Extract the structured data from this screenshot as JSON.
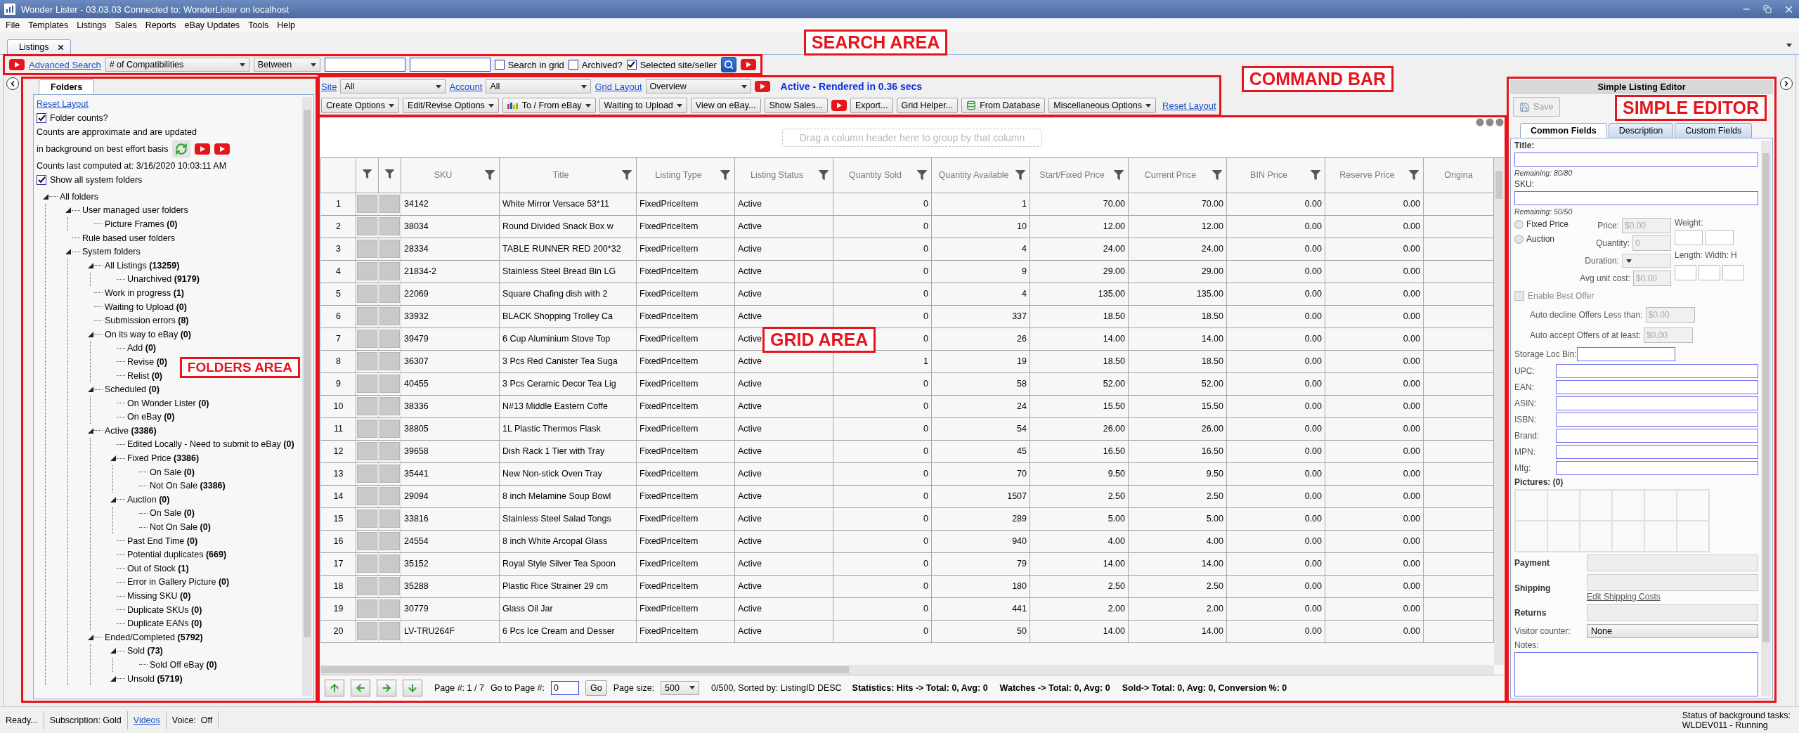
{
  "window": {
    "title": "Wonder Lister - 03.03.03 Connected to: WonderLister on localhost"
  },
  "menu": [
    "File",
    "Templates",
    "Listings",
    "Sales",
    "Reports",
    "eBay Updates",
    "Tools",
    "Help"
  ],
  "tabs": [
    {
      "label": "Listings",
      "selected": true
    }
  ],
  "search": {
    "annotation": "SEARCH AREA",
    "link": "Advanced Search",
    "field": "# of Compatibilities",
    "operator": "Between",
    "checkboxes": [
      {
        "label": "Search in grid",
        "checked": false
      },
      {
        "label": "Archived?",
        "checked": false
      },
      {
        "label": "Selected site/seller",
        "checked": true
      }
    ]
  },
  "folders": {
    "annotation": "FOLDERS AREA",
    "tab": "Folders",
    "reset_link": "Reset Layout",
    "folder_counts": {
      "label": "Folder counts?",
      "checked": true
    },
    "note_lines": [
      "Counts are approximate and are updated",
      "in background on best effort basis"
    ],
    "computed": "Counts last computed at: 3/16/2020 10:03:11 AM",
    "show_system": {
      "label": "Show all system folders",
      "checked": true
    },
    "tree": [
      {
        "name": "All folders",
        "expanded": true,
        "children": [
          {
            "name": "User managed user folders",
            "expanded": true,
            "children": [
              {
                "name": "Picture Frames",
                "count": "(0)"
              }
            ]
          },
          {
            "name": "Rule based user folders"
          },
          {
            "name": "System folders",
            "expanded": true,
            "children": [
              {
                "name": "All Listings",
                "count": "(13259)",
                "expanded": true,
                "children": [
                  {
                    "name": "Unarchived",
                    "count": "(9179)"
                  }
                ]
              },
              {
                "name": "Work in progress",
                "count": "(1)"
              },
              {
                "name": "Waiting to Upload",
                "count": "(0)"
              },
              {
                "name": "Submission errors",
                "count": "(8)"
              },
              {
                "name": "On its way to eBay",
                "count": "(0)",
                "expanded": true,
                "children": [
                  {
                    "name": "Add",
                    "count": "(0)"
                  },
                  {
                    "name": "Revise",
                    "count": "(0)"
                  },
                  {
                    "name": "Relist",
                    "count": "(0)"
                  }
                ]
              },
              {
                "name": "Scheduled",
                "count": "(0)",
                "expanded": true,
                "children": [
                  {
                    "name": "On Wonder Lister",
                    "count": "(0)"
                  },
                  {
                    "name": "On eBay",
                    "count": "(0)"
                  }
                ]
              },
              {
                "name": "Active",
                "count": "(3386)",
                "expanded": true,
                "children": [
                  {
                    "name": "Edited Locally - Need to submit to eBay",
                    "count": "(0)"
                  },
                  {
                    "name": "Fixed Price",
                    "count": "(3386)",
                    "expanded": true,
                    "children": [
                      {
                        "name": "On Sale",
                        "count": "(0)"
                      },
                      {
                        "name": "Not On Sale",
                        "count": "(3386)"
                      }
                    ]
                  },
                  {
                    "name": "Auction",
                    "count": "(0)",
                    "expanded": true,
                    "children": [
                      {
                        "name": "On Sale",
                        "count": "(0)"
                      },
                      {
                        "name": "Not On Sale",
                        "count": "(0)"
                      }
                    ]
                  },
                  {
                    "name": "Past End Time",
                    "count": "(0)"
                  },
                  {
                    "name": "Potential duplicates",
                    "count": "(669)"
                  },
                  {
                    "name": "Out of Stock",
                    "count": "(1)"
                  },
                  {
                    "name": "Error in Gallery Picture",
                    "count": "(0)"
                  },
                  {
                    "name": "Missing SKU",
                    "count": "(0)"
                  },
                  {
                    "name": "Duplicate SKUs",
                    "count": "(0)"
                  },
                  {
                    "name": "Duplicate EANs",
                    "count": "(0)"
                  }
                ]
              },
              {
                "name": "Ended/Completed",
                "count": "(5792)",
                "expanded": true,
                "children": [
                  {
                    "name": "Sold",
                    "count": "(73)",
                    "expanded": true,
                    "children": [
                      {
                        "name": "Sold Off eBay",
                        "count": "(0)"
                      }
                    ]
                  },
                  {
                    "name": "Unsold",
                    "count": "(5719)",
                    "expanded": true
                  }
                ]
              }
            ]
          }
        ]
      }
    ]
  },
  "command_bar": {
    "annotation": "COMMAND BAR",
    "filters": [
      {
        "label": "Site",
        "value": "All"
      },
      {
        "label": "Account",
        "value": "All"
      },
      {
        "label": "Grid Layout",
        "value": "Overview"
      }
    ],
    "status": "Active - Rendered in 0.36 secs",
    "buttons": [
      {
        "kind": "menu",
        "label": "Create Options"
      },
      {
        "kind": "menu",
        "label": "Edit/Revise Options"
      },
      {
        "kind": "transfer",
        "label": "To / From eBay"
      },
      {
        "kind": "menu",
        "label": "Waiting to Upload"
      },
      {
        "kind": "button",
        "label": "View on eBay..."
      },
      {
        "kind": "button",
        "label": "Show Sales..."
      },
      {
        "kind": "video"
      },
      {
        "kind": "button",
        "label": "Export..."
      },
      {
        "kind": "button",
        "label": "Grid Helper..."
      },
      {
        "kind": "database",
        "label": "From Database"
      },
      {
        "kind": "menu",
        "label": "Miscellaneous Options"
      },
      {
        "kind": "link",
        "label": "Reset Layout"
      }
    ]
  },
  "grid": {
    "annotation": "GRID AREA",
    "group_hint": "Drag a column header here to group by that column",
    "columns": [
      "SKU",
      "Title",
      "Listing Type",
      "Listing Status",
      "Quantity Sold",
      "Quantity Available",
      "Start/Fixed Price",
      "Current Price",
      "BIN Price",
      "Reserve Price",
      "Origina"
    ],
    "rows": [
      {
        "number": "1",
        "cells": [
          "34142",
          "White Mirror Versace 53*11",
          "FixedPriceItem",
          "Active",
          "0",
          "1",
          "70.00",
          "70.00",
          "0.00",
          "0.00"
        ]
      },
      {
        "number": "2",
        "cells": [
          "38034",
          "Round Divided Snack Box w",
          "FixedPriceItem",
          "Active",
          "0",
          "10",
          "12.00",
          "12.00",
          "0.00",
          "0.00"
        ]
      },
      {
        "number": "3",
        "cells": [
          "28334",
          "TABLE RUNNER RED 200*32",
          "FixedPriceItem",
          "Active",
          "0",
          "4",
          "24.00",
          "24.00",
          "0.00",
          "0.00"
        ]
      },
      {
        "number": "4",
        "cells": [
          "21834-2",
          "Stainless Steel Bread Bin LG",
          "FixedPriceItem",
          "Active",
          "0",
          "9",
          "29.00",
          "29.00",
          "0.00",
          "0.00"
        ]
      },
      {
        "number": "5",
        "cells": [
          "22069",
          "Square Chafing dish with 2",
          "FixedPriceItem",
          "Active",
          "0",
          "4",
          "135.00",
          "135.00",
          "0.00",
          "0.00"
        ]
      },
      {
        "number": "6",
        "cells": [
          "33932",
          "BLACK Shopping Trolley Ca",
          "FixedPriceItem",
          "Active",
          "0",
          "337",
          "18.50",
          "18.50",
          "0.00",
          "0.00"
        ]
      },
      {
        "number": "7",
        "cells": [
          "39479",
          "6 Cup Aluminium Stove Top",
          "FixedPriceItem",
          "Active",
          "0",
          "26",
          "14.00",
          "14.00",
          "0.00",
          "0.00"
        ]
      },
      {
        "number": "8",
        "cells": [
          "36307",
          "3 Pcs Red Canister Tea Suga",
          "FixedPriceItem",
          "Active",
          "1",
          "19",
          "18.50",
          "18.50",
          "0.00",
          "0.00"
        ]
      },
      {
        "number": "9",
        "cells": [
          "40455",
          "3 Pcs Ceramic Decor Tea Lig",
          "FixedPriceItem",
          "Active",
          "0",
          "58",
          "52.00",
          "52.00",
          "0.00",
          "0.00"
        ]
      },
      {
        "number": "10",
        "cells": [
          "38336",
          "N#13 Middle Eastern Coffe",
          "FixedPriceItem",
          "Active",
          "0",
          "24",
          "15.50",
          "15.50",
          "0.00",
          "0.00"
        ]
      },
      {
        "number": "11",
        "cells": [
          "38805",
          "1L Plastic Thermos Flask",
          "FixedPriceItem",
          "Active",
          "0",
          "54",
          "26.00",
          "26.00",
          "0.00",
          "0.00"
        ]
      },
      {
        "number": "12",
        "cells": [
          "39658",
          "Dish Rack 1 Tier with Tray",
          "FixedPriceItem",
          "Active",
          "0",
          "45",
          "16.50",
          "16.50",
          "0.00",
          "0.00"
        ]
      },
      {
        "number": "13",
        "cells": [
          "35441",
          "New Non-stick Oven Tray",
          "FixedPriceItem",
          "Active",
          "0",
          "70",
          "9.50",
          "9.50",
          "0.00",
          "0.00"
        ]
      },
      {
        "number": "14",
        "cells": [
          "29094",
          "8 inch Melamine Soup Bowl",
          "FixedPriceItem",
          "Active",
          "0",
          "1507",
          "2.50",
          "2.50",
          "0.00",
          "0.00"
        ]
      },
      {
        "number": "15",
        "cells": [
          "33816",
          "Stainless Steel Salad Tongs",
          "FixedPriceItem",
          "Active",
          "0",
          "289",
          "5.00",
          "5.00",
          "0.00",
          "0.00"
        ]
      },
      {
        "number": "16",
        "cells": [
          "24554",
          "8 inch White Arcopal Glass",
          "FixedPriceItem",
          "Active",
          "0",
          "940",
          "4.00",
          "4.00",
          "0.00",
          "0.00"
        ]
      },
      {
        "number": "17",
        "cells": [
          "35152",
          "Royal Style Silver Tea Spoon",
          "FixedPriceItem",
          "Active",
          "0",
          "79",
          "14.00",
          "14.00",
          "0.00",
          "0.00"
        ]
      },
      {
        "number": "18",
        "cells": [
          "35288",
          "Plastic Rice Strainer 29 cm",
          "FixedPriceItem",
          "Active",
          "0",
          "180",
          "2.50",
          "2.50",
          "0.00",
          "0.00"
        ]
      },
      {
        "number": "19",
        "cells": [
          "30779",
          "Glass Oil Jar",
          "FixedPriceItem",
          "Active",
          "0",
          "441",
          "2.00",
          "2.00",
          "0.00",
          "0.00"
        ]
      },
      {
        "number": "20",
        "cells": [
          "LV-TRU264F",
          "6 Pcs Ice Cream and Desser",
          "FixedPriceItem",
          "Active",
          "0",
          "50",
          "14.00",
          "14.00",
          "0.00",
          "0.00"
        ]
      }
    ],
    "footer": {
      "page": "Page #: 1 / 7",
      "goto_label": "Go to Page #:",
      "goto_value": "0",
      "go": "Go",
      "page_size_label": "Page size:",
      "page_size": "500",
      "sort_info": "0/500, Sorted by: ListingID DESC",
      "stats": [
        "Statistics: Hits -> Total: 0, Avg: 0",
        "Watches -> Total: 0, Avg: 0",
        "Sold-> Total: 0, Avg: 0, Conversion %: 0"
      ]
    }
  },
  "editor": {
    "annotation": "SIMPLE EDITOR",
    "title": "Simple Listing Editor",
    "save": {
      "label": "Save",
      "disabled": true
    },
    "tabs": [
      {
        "label": "Common Fields",
        "selected": true
      },
      {
        "label": "Description",
        "selected": false
      },
      {
        "label": "Custom Fields",
        "selected": false
      }
    ],
    "title_label": "Title:",
    "title_remaining": "Remaining: 80/80",
    "sku_label": "SKU:",
    "sku_remaining": "Remaining: 50/50",
    "format_options": [
      {
        "label": "Fixed Price",
        "selected": false
      },
      {
        "label": "Auction",
        "selected": false
      }
    ],
    "price": {
      "label": "Price:",
      "value": "$0.00",
      "disabled": true
    },
    "quantity": {
      "label": "Quantity:",
      "value": "0",
      "disabled": true
    },
    "weight_label": "Weight:",
    "dimension_labels": [
      "Length:",
      "Width:",
      "H"
    ],
    "duration_label": "Duration:",
    "avg_cost": {
      "label": "Avg unit cost:",
      "value": "$0.00",
      "disabled": true
    },
    "best_offer": {
      "label": "Enable Best Offer",
      "checked": false,
      "disabled": true
    },
    "auto_decline": {
      "label": "Auto decline Offers Less than:",
      "value": "$0.00",
      "disabled": true
    },
    "auto_accept": {
      "label": "Auto accept Offers of at least:",
      "value": "$0.00",
      "disabled": true
    },
    "storage_label": "Storage Loc Bin:",
    "id_fields": [
      "UPC:",
      "EAN:",
      "ASIN:",
      "ISBN:",
      "Brand:",
      "MPN:",
      "Mfg:"
    ],
    "pictures_label": "Pictures: (0)",
    "policies": [
      {
        "label": "Payment"
      },
      {
        "label": "Shipping",
        "link": "Edit Shipping Costs"
      },
      {
        "label": "Returns"
      }
    ],
    "visitor_counter": {
      "label": "Visitor counter:",
      "value": "None"
    },
    "notes_label": "Notes:"
  },
  "status_bar": {
    "items": [
      {
        "kind": "text",
        "text": "Ready..."
      },
      {
        "kind": "text",
        "text": "Subscription: Gold"
      },
      {
        "kind": "link",
        "text": "Videos"
      },
      {
        "kind": "text",
        "text": "Voice:  Off"
      }
    ],
    "background_tasks": [
      "Status of background tasks:",
      "WLDEV011 - Running"
    ]
  }
}
